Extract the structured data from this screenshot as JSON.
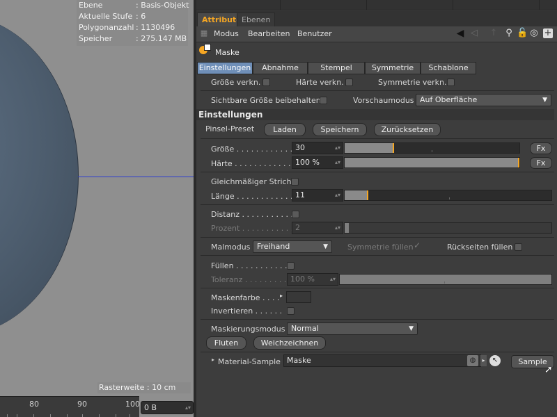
{
  "viewport": {
    "info": [
      {
        "label": "Ebene",
        "value": ": Basis-Objekt"
      },
      {
        "label": "Aktuelle Stufe",
        "value": ": 6"
      },
      {
        "label": "Polygonanzahl",
        "value": ": 1130496"
      },
      {
        "label": "Speicher",
        "value": ": 275.147 MB"
      }
    ],
    "raster": "Rasterweite : 10 cm",
    "ruler_ticks": [
      "80",
      "90",
      "100"
    ],
    "bytes_field": "0 B"
  },
  "panel": {
    "tabs": [
      {
        "label": "Attribute",
        "active": true
      },
      {
        "label": "Ebenen",
        "active": false
      }
    ],
    "menu": [
      "Modus",
      "Bearbeiten",
      "Benutzer"
    ],
    "object_title": "Maske",
    "subtabs": [
      "Einstellungen",
      "Abnahme",
      "Stempel",
      "Symmetrie",
      "Schablone"
    ],
    "link_row": {
      "size_link": "Größe verkn.",
      "hardness_link": "Härte verkn.",
      "symmetry_link": "Symmetrie verkn."
    },
    "visible_size": "Sichtbare Größe beibehalten",
    "preview_mode_label": "Vorschaumodus",
    "preview_mode_value": "Auf Oberfläche",
    "section_title": "Einstellungen",
    "preset": {
      "label": "Pinsel-Preset",
      "load": "Laden",
      "save": "Speichern",
      "reset": "Zurücksetzen"
    },
    "size": {
      "label": "Größe . . . . . . . . . . . .",
      "value": "30",
      "slider": 0.28,
      "fx": "Fx"
    },
    "hardness": {
      "label": "Härte . . . . . . . . . . . .",
      "value": "100 %",
      "slider": 1.0,
      "fx": "Fx"
    },
    "stroke": {
      "label": "Gleichmäßiger Strich"
    },
    "length": {
      "label": "Länge . . . . . . . . . . . .",
      "value": "11",
      "slider": 0.11
    },
    "distance": {
      "label": "Distanz . . . . . . . . . . ."
    },
    "percent": {
      "label": "Prozent . . . . . . . . . . .",
      "value": "2",
      "slider": 0.02
    },
    "paint_mode": {
      "label": "Malmodus",
      "value": "Freihand",
      "sym_fill": "Symmetrie füllen",
      "sym_check": "✓",
      "back_fill": "Rückseiten füllen"
    },
    "fill": {
      "label": "Füllen . . . . . . . . . . . ."
    },
    "tolerance": {
      "label": "Toleranz . . . . . . . . .",
      "value": "100 %",
      "slider": 1.0
    },
    "mask_color": {
      "label": "Maskenfarbe . . . ."
    },
    "invert": {
      "label": "Invertieren . . . . . ."
    },
    "mask_mode": {
      "label": "Maskierungsmodus",
      "value": "Normal"
    },
    "flood": "Fluten",
    "blur": "Weichzeichnen",
    "material_sample": {
      "label": "Material-Sample",
      "value": "Maske",
      "sample_button": "Sample"
    }
  }
}
